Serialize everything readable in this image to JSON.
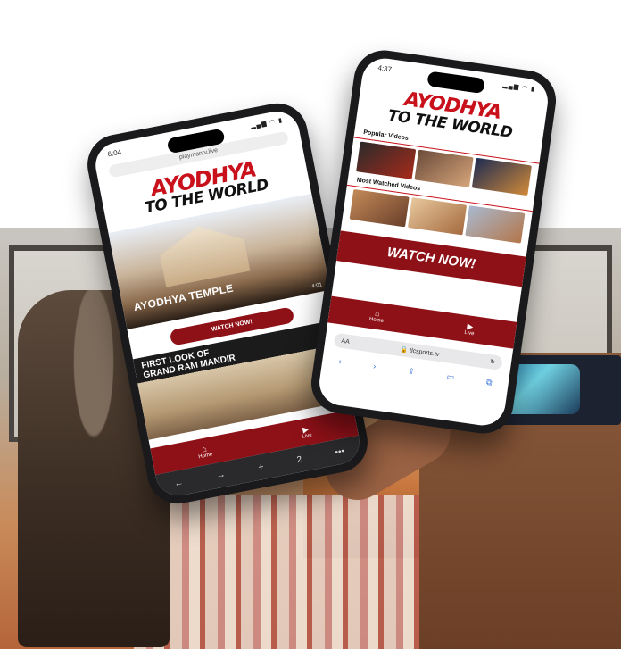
{
  "phone_left": {
    "status_time": "6:04",
    "status_icons": "▂▄▆ ◠ ▮",
    "url": "playmantv.live",
    "logo_line1": "AYODHYA",
    "logo_line2": "TO THE WORLD",
    "hero_caption": "AYODHYA TEMPLE",
    "hero_duration": "4:01",
    "watch_button": "WATCH NOW!",
    "feature_line1": "FIRST LOOK OF",
    "feature_line2": "GRAND RAM MANDIR",
    "tabs": [
      {
        "icon": "⌂",
        "label": "Home"
      },
      {
        "icon": "▶",
        "label": "Live"
      }
    ],
    "nav": [
      "←",
      "→",
      "+",
      "2",
      "•••"
    ]
  },
  "phone_right": {
    "status_time": "4:37",
    "status_icons": "▂▄▆ ◠ ▮",
    "logo_line1": "AYODHYA",
    "logo_line2": "TO THE WORLD",
    "popular_label": "Popular Videos",
    "most_watched_label": "Most Watched Videos",
    "watch_button": "WATCH NOW!",
    "tabs": [
      {
        "icon": "⌂",
        "label": "Home"
      },
      {
        "icon": "▶",
        "label": "Live"
      }
    ],
    "url_left": "AA",
    "url": "🔒 tlcsports.tv",
    "url_right": "↻",
    "tools": [
      "‹",
      "›",
      "⇪",
      "▭",
      "⧉"
    ]
  },
  "colors": {
    "brand_red": "#c8111b",
    "bar_red": "#8f1118"
  }
}
